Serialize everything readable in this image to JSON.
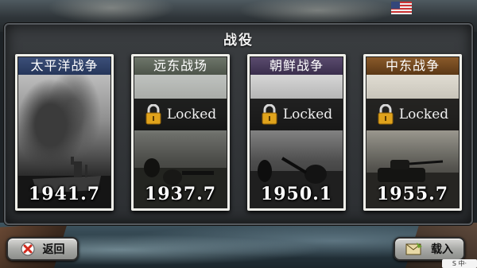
{
  "screen": {
    "title": "战役"
  },
  "campaigns": [
    {
      "name": "太平洋战争",
      "year": "1941.7",
      "locked": false,
      "accent": "#2f4068"
    },
    {
      "name": "远东战场",
      "year": "1937.7",
      "locked": true,
      "lock_label": "Locked",
      "accent": "#5d6459"
    },
    {
      "name": "朝鲜战争",
      "year": "1950.1",
      "locked": true,
      "lock_label": "Locked",
      "accent": "#4a3d5d"
    },
    {
      "name": "中东战争",
      "year": "1955.7",
      "locked": true,
      "lock_label": "Locked",
      "accent": "#724a22"
    }
  ],
  "buttons": {
    "back_label": "返回",
    "back_icon": "close-x-icon",
    "load_label": "载入",
    "load_icon": "envelope-icon"
  },
  "colors": {
    "lock_gold": "#e0a31c",
    "back_icon_red": "#d22a1e"
  }
}
